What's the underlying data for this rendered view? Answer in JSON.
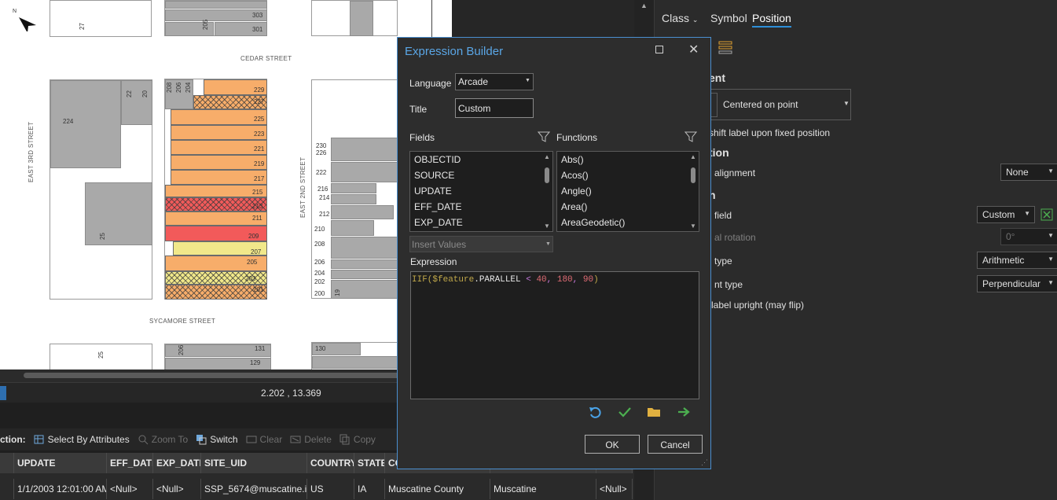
{
  "map": {
    "streets": {
      "cedar": "CEDAR STREET",
      "sycamore": "SYCAMORE STREET",
      "east3rd": "EAST 3RD STREET",
      "east2nd": "EAST 2ND STREET"
    },
    "parcel_numbers": {
      "top_block": [
        "303",
        "301"
      ],
      "mid_block": [
        "229",
        "227",
        "225",
        "223",
        "221",
        "219",
        "217",
        "215",
        "213",
        "211",
        "209",
        "207",
        "205",
        "203",
        "201"
      ],
      "mid_block_top": [
        "208",
        "206",
        "204"
      ],
      "left_block": [
        "224",
        "22",
        "20",
        "25"
      ],
      "right_block": [
        "230",
        "226",
        "222",
        "216",
        "214",
        "212",
        "210",
        "208",
        "206",
        "204",
        "202",
        "200",
        "19"
      ],
      "bottom": [
        "131",
        "129",
        "130",
        "206",
        "25"
      ],
      "top_misc": [
        "27",
        "205"
      ]
    },
    "colors": {
      "orange": "#f7ad6a",
      "red": "#f25a5a",
      "yellow": "#f1e88a",
      "gray": "#a9a9a9"
    }
  },
  "status": {
    "coordinates": "2.202 , 13.369"
  },
  "table_toolbar": {
    "prefix": "ction:",
    "select_by_attributes": "Select By Attributes",
    "zoom_to": "Zoom To",
    "switch": "Switch",
    "clear": "Clear",
    "delete": "Delete",
    "copy": "Copy"
  },
  "table": {
    "columns": [
      "UPDATE",
      "EFF_DATE",
      "EXP_DATE",
      "SITE_UID",
      "COUNTRY",
      "STATE",
      "CO",
      "",
      ""
    ],
    "row": [
      "1/1/2003 12:01:00 AM",
      "<Null>",
      "<Null>",
      "SSP_5674@muscatine.i...",
      "US",
      "IA",
      "Muscatine County",
      "Muscatine",
      "<Null>"
    ]
  },
  "right_panel": {
    "tabs": [
      "Class",
      "Symbol",
      "Position"
    ],
    "active_tab": "Position",
    "section_placement": "ent",
    "placement_value": "Centered on point",
    "shift_label": "shift label upon fixed position",
    "section_orientation": "tion",
    "alignment_label": "alignment",
    "alignment_value": "None",
    "section_rotation": "n",
    "field_label": "field",
    "field_value": "Custom",
    "additional_rotation_label": "al rotation",
    "additional_rotation_value": "0°",
    "rotation_type_label": "type",
    "rotation_type_value": "Arithmetic",
    "alignment_type_label": "nt type",
    "alignment_type_value": "Perpendicular",
    "upright_label": "label upright (may flip)"
  },
  "dialog": {
    "title": "Expression Builder",
    "language_label": "Language",
    "language_value": "Arcade",
    "title_label": "Title",
    "title_value": "Custom",
    "fields_label": "Fields",
    "functions_label": "Functions",
    "fields": [
      "OBJECTID",
      "SOURCE",
      "UPDATE",
      "EFF_DATE",
      "EXP_DATE"
    ],
    "functions": [
      "Abs()",
      "Acos()",
      "Angle()",
      "Area()",
      "AreaGeodetic()"
    ],
    "insert_values": "Insert Values",
    "expression_label": "Expression",
    "expression": {
      "fn": "IIF(",
      "var": "$feature",
      "prop": ".PARALLEL",
      "op": " < ",
      "n1": "40",
      "c1": ", ",
      "n2": "180",
      "c2": ", ",
      "n3": "90",
      "close": ")"
    },
    "ok": "OK",
    "cancel": "Cancel"
  }
}
